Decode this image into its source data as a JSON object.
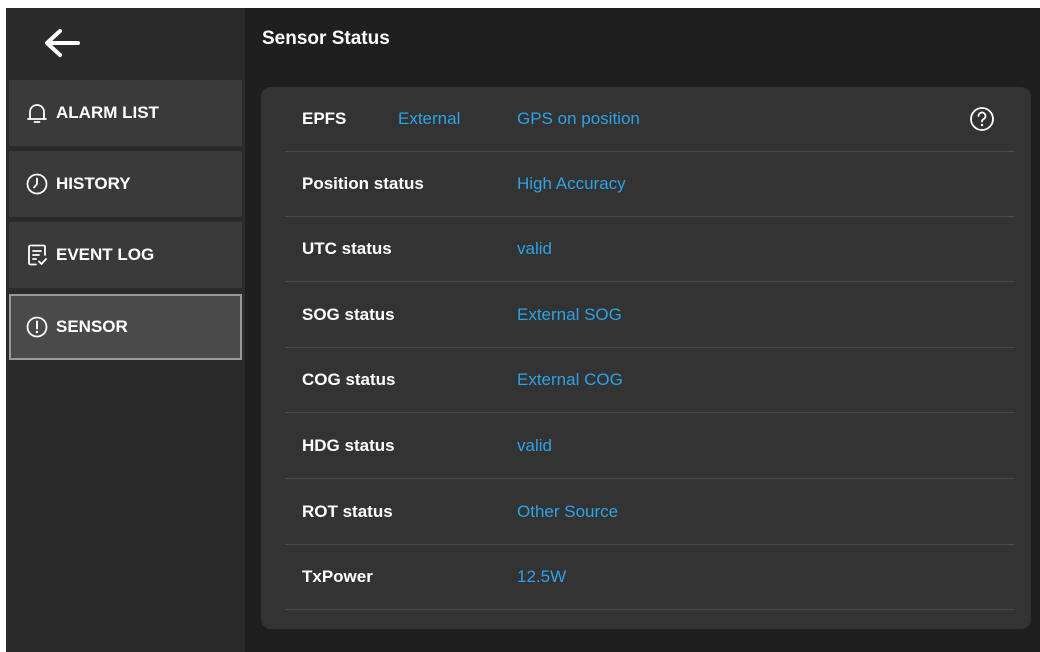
{
  "header": {
    "title": "Sensor Status"
  },
  "sidebar": {
    "back": "arrow-left-icon",
    "items": [
      {
        "label": "ALARM LIST",
        "icon": "bell-icon"
      },
      {
        "label": "HISTORY",
        "icon": "clock-icon"
      },
      {
        "label": "EVENT LOG",
        "icon": "checklist-icon"
      },
      {
        "label": "SENSOR",
        "icon": "exclamation-circle-icon",
        "active": true
      }
    ]
  },
  "sensor": {
    "epfs": {
      "label": "EPFS",
      "source": "External",
      "value": "GPS on position"
    },
    "rows": [
      {
        "label": "Position status",
        "value": "High Accuracy"
      },
      {
        "label": "UTC status",
        "value": "valid"
      },
      {
        "label": "SOG status",
        "value": "External SOG"
      },
      {
        "label": "COG status",
        "value": "External COG"
      },
      {
        "label": "HDG status",
        "value": "valid"
      },
      {
        "label": "ROT status",
        "value": "Other Source"
      },
      {
        "label": "TxPower",
        "value": "12.5W"
      }
    ]
  },
  "colors": {
    "background": "#1f1f1f",
    "sidebar": "#2b2b2b",
    "panel": "#333333",
    "accent": "#2ba3e6",
    "text": "#ffffff"
  }
}
